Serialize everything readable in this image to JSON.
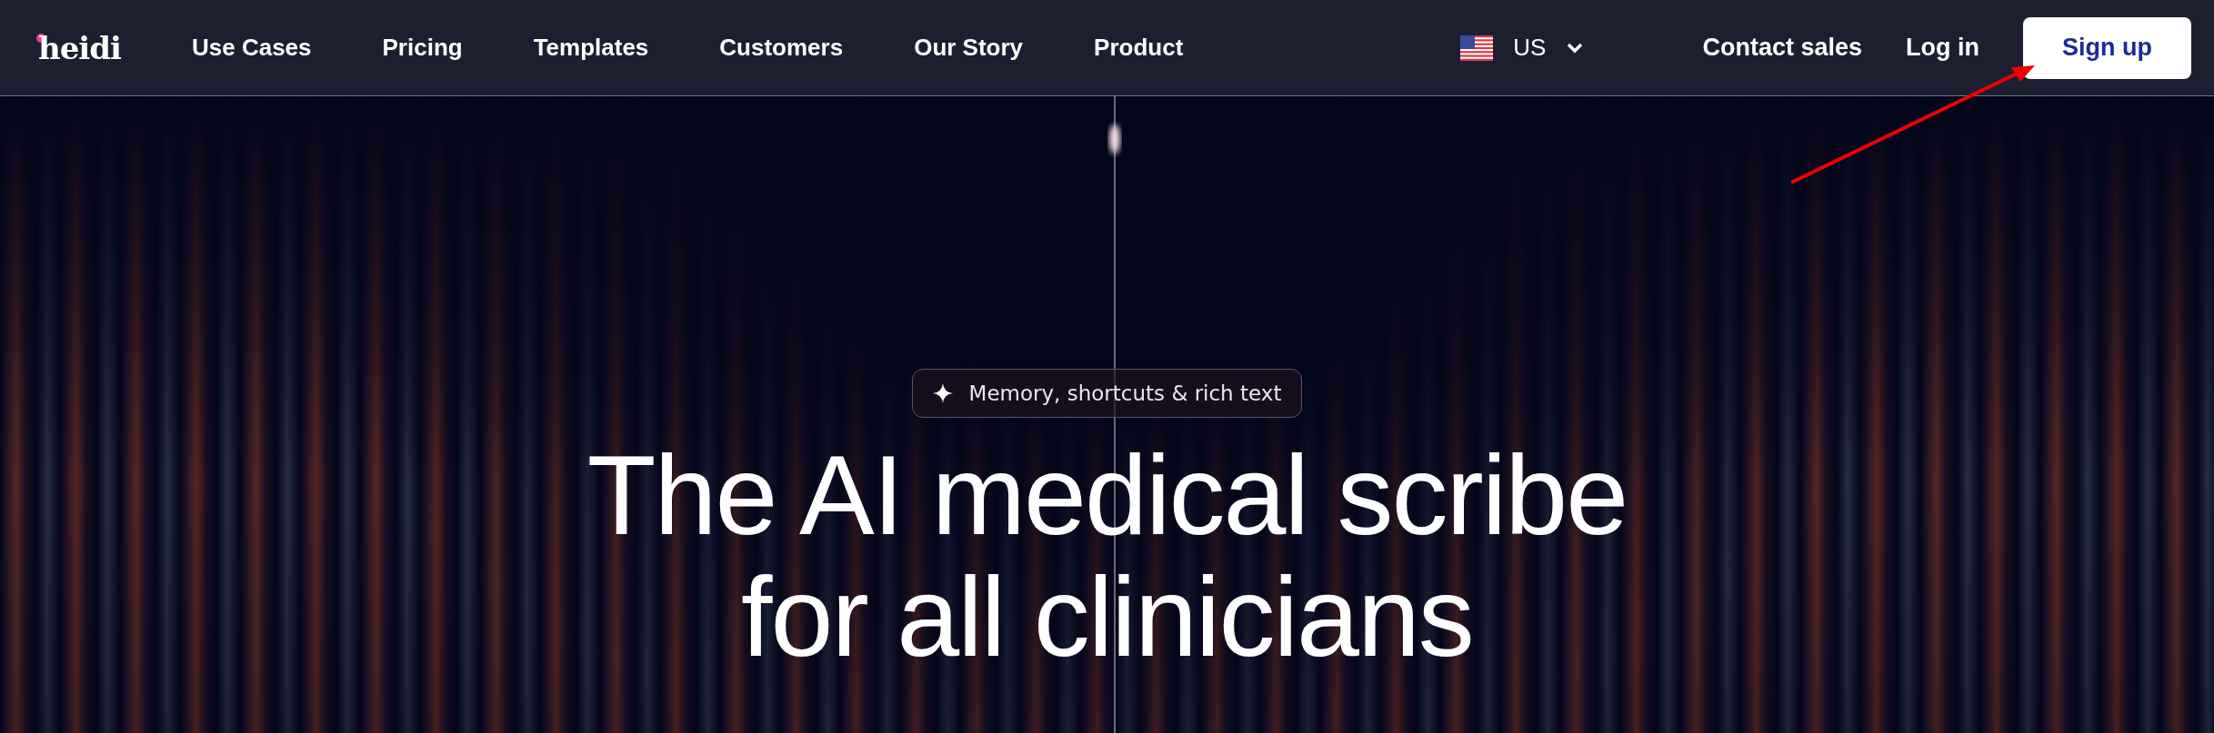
{
  "nav": {
    "logo": "heidi",
    "links": [
      "Use Cases",
      "Pricing",
      "Templates",
      "Customers",
      "Our Story",
      "Product"
    ],
    "region": "US",
    "contact": "Contact sales",
    "login": "Log in",
    "signup": "Sign up"
  },
  "hero": {
    "badge": "Memory, shortcuts & rich text",
    "heading": [
      "The AI medical scribe",
      "for all clinicians"
    ]
  }
}
